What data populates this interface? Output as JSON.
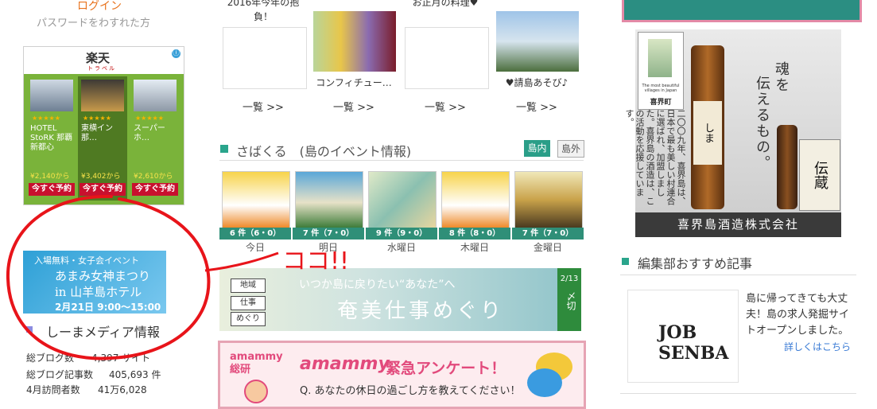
{
  "left": {
    "login": "ログイン",
    "forgot_password": "パスワードをわすれた方",
    "rakuten_ad": {
      "logo": "楽天",
      "sub": "トラベル",
      "info_icon": "ⓘ",
      "close": "×",
      "hotels": [
        {
          "stars": "★★★★★",
          "name": "HOTEL StoRK 那覇新都心",
          "price": "¥2,140から",
          "button": "今すぐ予約"
        },
        {
          "stars": "★★★★★",
          "name": "東横イン那…",
          "price": "¥3,402から",
          "button": "今すぐ予約"
        },
        {
          "stars": "★★★★★",
          "name": "スーパーホ…",
          "price": "¥2,610から",
          "button": "今すぐ予約"
        }
      ]
    },
    "festival_banner": {
      "line1": "入場無料・女子会イベント",
      "line2": "あまみ女神まつり",
      "line3": "in 山羊島ホテル",
      "line4": "2月21日 9:00～15:00"
    },
    "media_info": {
      "title": "しーまメディア情報",
      "stats": [
        {
          "label": "総ブログ数",
          "value": "4,397 サイト"
        },
        {
          "label": "総ブログ記事数",
          "value": "405,693 件"
        },
        {
          "label": "4月訪問者数",
          "value": "41万6,028"
        }
      ]
    }
  },
  "center": {
    "top_cells": [
      {
        "caption": "2016年今年の抱負！",
        "more": "一覧 >>"
      },
      {
        "caption": "コンフィチュー…",
        "more": "一覧 >>"
      },
      {
        "caption": "お正月の料理♥",
        "more": "一覧 >>"
      },
      {
        "caption": "♥請島あそび♪",
        "more": "一覧 >>"
      }
    ],
    "sabakuru": {
      "title": "さばくる　(島のイベント情報)",
      "tab_inside": "島内",
      "tab_outside": "島外",
      "days": [
        {
          "count": "6 件（6・0）",
          "label": "今日"
        },
        {
          "count": "7 件（7・0）",
          "label": "明日"
        },
        {
          "count": "9 件（9・0）",
          "label": "水曜日"
        },
        {
          "count": "8 件（8・0）",
          "label": "木曜日"
        },
        {
          "count": "7 件（7・0）",
          "label": "金曜日"
        }
      ]
    },
    "shigoto_banner": {
      "box1": "地域",
      "box2": "仕事",
      "box3": "めぐり",
      "tagline": "いつか島に戻りたい“あなた”へ",
      "title": "奄美仕事めぐり",
      "deadline_date": "2/13",
      "deadline_label": "〆切"
    },
    "ammy_banner": {
      "left_label": "amammy 総研",
      "logo": "amammy",
      "headline": "緊急アンケート！",
      "question": "Q. あなたの休日の過ごし方を教えてください！"
    },
    "scribble": "ココ!!"
  },
  "right": {
    "shochu_ad": {
      "badge_text": "The most beautiful villages in Japan",
      "badge_name": "喜界町",
      "catch1": "魂を",
      "catch2": "伝えるもの。",
      "description": "二〇〇九年、喜界島は、日本で最も美しい村連合に選ばれ、加盟しました。喜界島の酒造は、この活動を応援しています。",
      "label_a": "しま",
      "label_b": "伝蔵",
      "footer": "喜界島酒造株式会社"
    },
    "recommend": {
      "title": "編集部おすすめ記事",
      "article_text": "島に帰ってきても大丈夫！島の求人発掘サイトオープンしました。",
      "article_image_label": "JOB SENBA",
      "more_link": "詳しくはこちら"
    }
  },
  "colors": {
    "accent_green": "#2aa58c",
    "login_orange": "#e8731e",
    "scribble_red": "#e8141a"
  }
}
